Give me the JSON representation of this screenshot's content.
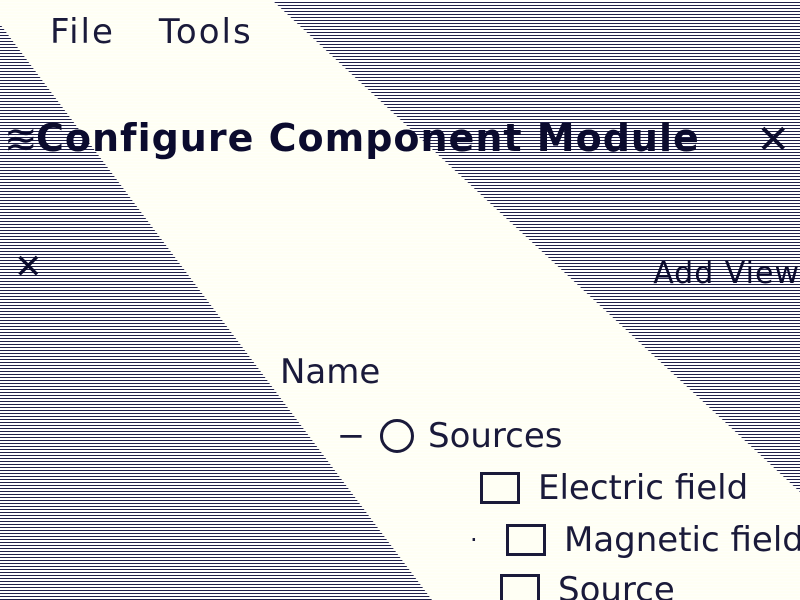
{
  "menu": {
    "items": [
      "File",
      "Tools"
    ]
  },
  "window": {
    "title": "Configure Component Module",
    "close_symbol": "✕",
    "icon_symbol": "≋"
  },
  "panel": {
    "close_symbol": "✕",
    "add_view_label": "Add View"
  },
  "tree": {
    "header": "Name",
    "rows": [
      {
        "label": "Sources",
        "toggle": "−",
        "icon": "folder-icon"
      },
      {
        "label": "Electric field",
        "toggle": "",
        "icon": "document-icon"
      },
      {
        "label": "Magnetic field",
        "toggle": "·",
        "icon": "document-icon"
      },
      {
        "label": "Source",
        "toggle": "",
        "icon": "document-icon"
      }
    ]
  },
  "colors": {
    "dark": "#0b0b2e",
    "band": "#fffff4"
  }
}
